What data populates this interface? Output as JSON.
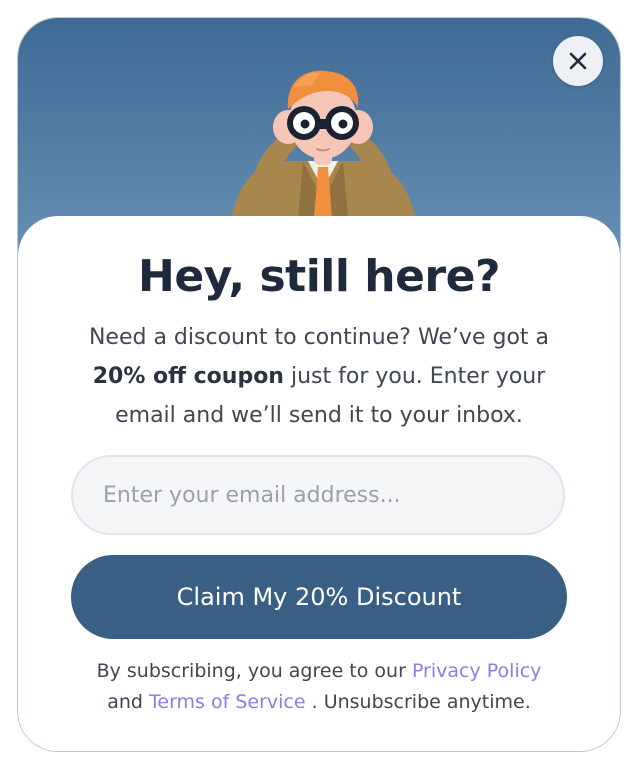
{
  "modal": {
    "title": "Hey, still here?",
    "body_part1": "Need a discount to continue? We’ve got a ",
    "body_bold": "20% off coupon",
    "body_part2": " just for you. Enter your email and we’ll send it to your inbox.",
    "close_icon": "close-icon",
    "hero_icon": "person-with-binoculars-icon"
  },
  "form": {
    "email_placeholder": "Enter your email address...",
    "email_value": "",
    "button_label": "Claim My 20% Discount"
  },
  "legal": {
    "prefix": "By subscribing, you agree to our ",
    "privacy_link": "Privacy Policy",
    "conjunction": "and ",
    "terms_link": "Terms of Service",
    "suffix": " . Unsubscribe anytime."
  },
  "colors": {
    "hero_top": "#3f6a94",
    "hero_bottom": "#6991b6",
    "button": "#3a5f84",
    "link": "#8b7ee0",
    "title": "#1f2a3c"
  }
}
